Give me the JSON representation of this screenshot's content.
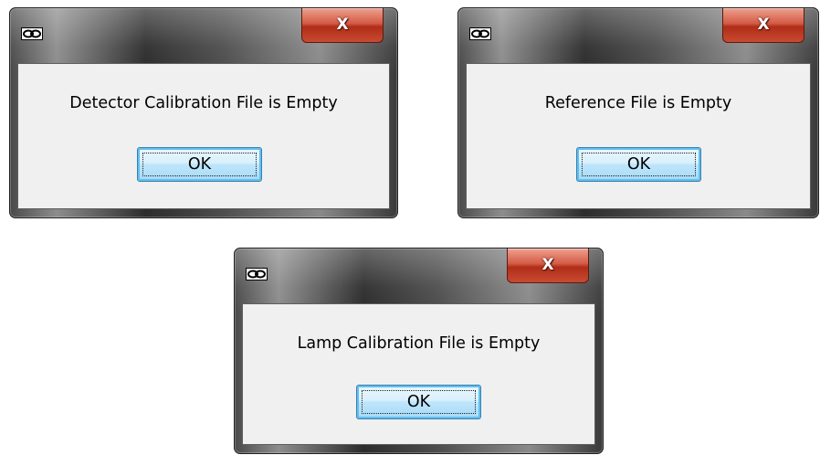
{
  "dialogs": [
    {
      "message": "Detector Calibration File is Empty",
      "ok_label": "OK",
      "close_label": "X",
      "icon": "app-icon"
    },
    {
      "message": "Reference File is Empty",
      "ok_label": "OK",
      "close_label": "X",
      "icon": "app-icon"
    },
    {
      "message": "Lamp Calibration File is Empty",
      "ok_label": "OK",
      "close_label": "X",
      "icon": "app-icon"
    }
  ],
  "colors": {
    "client_bg": "#f0f0f0",
    "close_red": "#c84a33",
    "ok_blue": "#bee6fd",
    "frame_dark": "#2c2c2c"
  }
}
